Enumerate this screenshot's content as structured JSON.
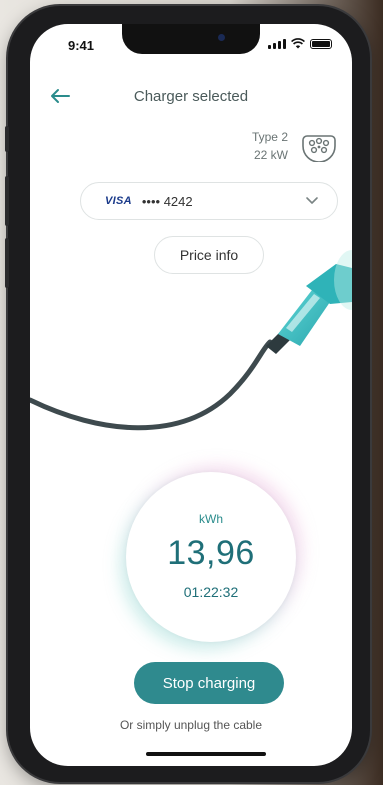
{
  "status_bar": {
    "time": "9:41"
  },
  "header": {
    "title": "Charger selected"
  },
  "charger": {
    "type": "Type 2",
    "power": "22 kW"
  },
  "payment": {
    "brand": "VISA",
    "card_masked": "•••• 4242"
  },
  "price_info_label": "Price info",
  "session": {
    "unit": "kWh",
    "energy": "13,96",
    "duration": "01:22:32"
  },
  "actions": {
    "stop_label": "Stop charging",
    "hint": "Or simply unplug the cable"
  },
  "colors": {
    "accent": "#2f8a8e",
    "connector": "#3bbfc4",
    "cable": "#3e4a4e"
  },
  "icons": {
    "back": "arrow-left-icon",
    "plug": "type2-connector-icon",
    "dropdown": "chevron-down-icon"
  }
}
